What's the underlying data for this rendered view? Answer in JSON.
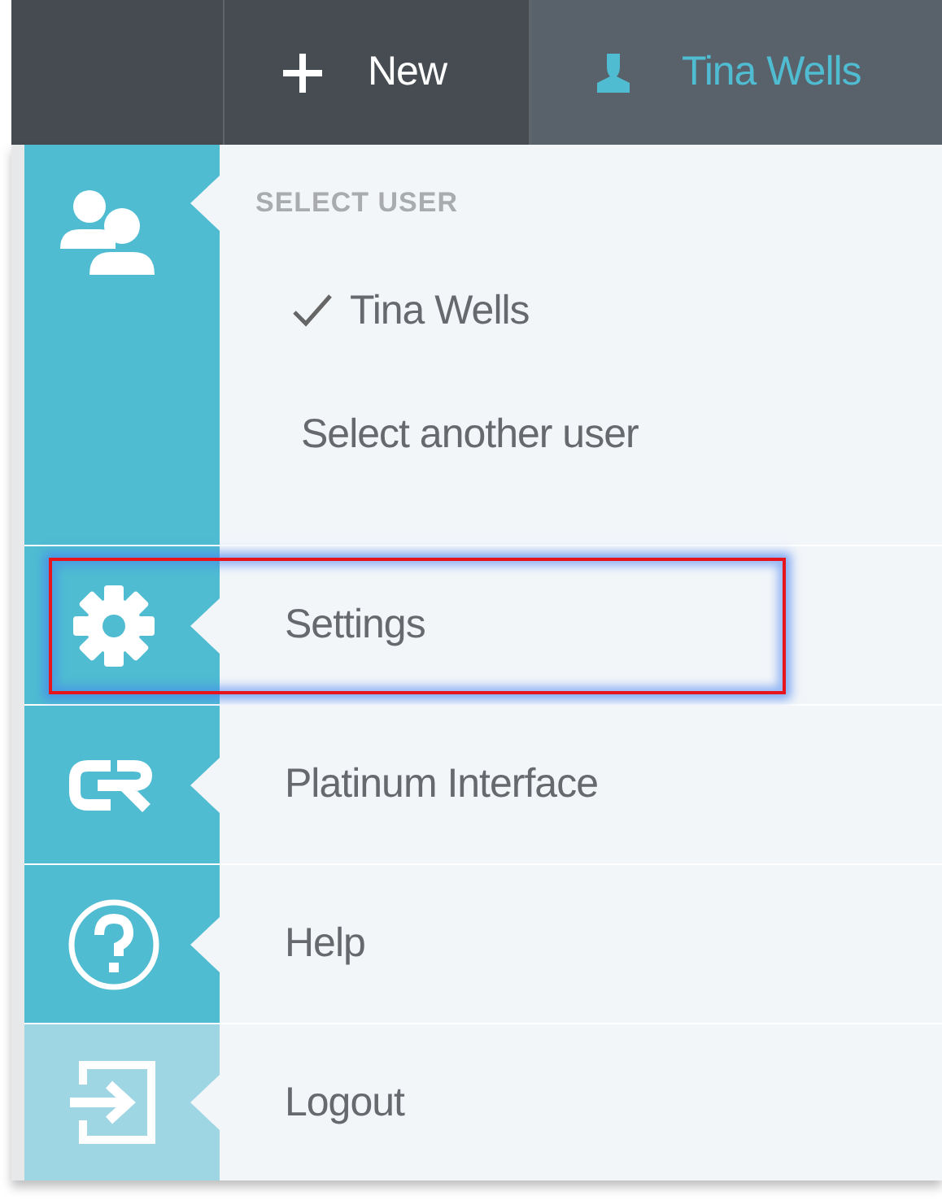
{
  "top_bar": {
    "new_button": {
      "label": "New"
    },
    "user_button": {
      "label": "Tina Wells"
    }
  },
  "menu": {
    "sections": [
      {
        "kind": "users",
        "header": "SELECT USER",
        "options": [
          {
            "label": "Tina Wells",
            "checked": true
          },
          {
            "label": "Select another user",
            "checked": false
          }
        ]
      },
      {
        "kind": "settings",
        "label": "Settings",
        "highlighted": true
      },
      {
        "kind": "interface",
        "label": "Platinum Interface",
        "highlighted": false
      },
      {
        "kind": "help",
        "label": "Help",
        "highlighted": false
      },
      {
        "kind": "logout",
        "label": "Logout",
        "highlighted": false
      }
    ]
  }
}
